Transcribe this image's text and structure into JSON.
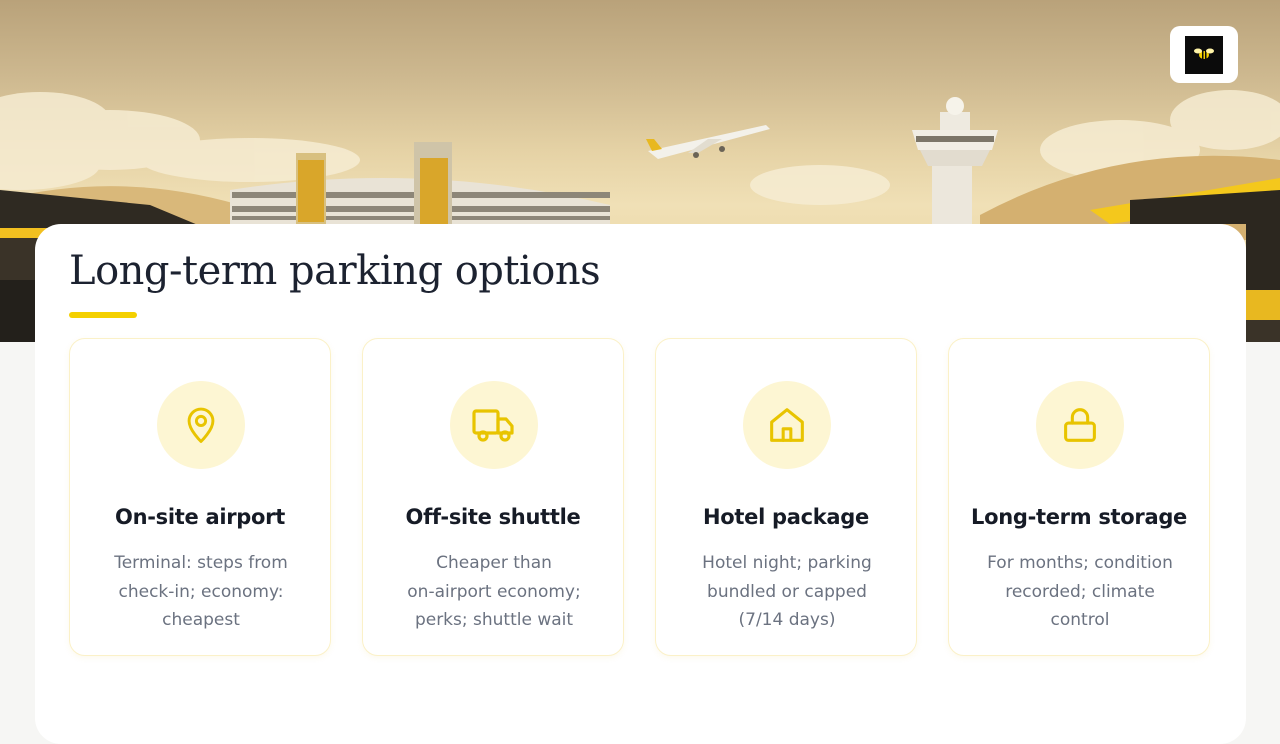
{
  "title": "Long-term parking options",
  "colors": {
    "accent": "#f4d000",
    "icon_stroke": "#e8c400",
    "icon_bg": "#fdf6d3",
    "title_text": "#1c2230",
    "body_text": "#6b7280"
  },
  "logo": {
    "icon": "bee-logo-icon"
  },
  "cards": [
    {
      "icon": "map-pin-icon",
      "title": "On-site airport",
      "lines": [
        "Terminal: steps from",
        "check-in; economy:",
        "cheapest"
      ]
    },
    {
      "icon": "truck-icon",
      "title": "Off-site shuttle",
      "lines": [
        "Cheaper than",
        "on-airport economy;",
        "perks; shuttle wait"
      ]
    },
    {
      "icon": "house-icon",
      "title": "Hotel package",
      "lines": [
        "Hotel night; parking",
        "bundled or capped",
        "(7/14 days)"
      ]
    },
    {
      "icon": "lock-icon",
      "title": "Long-term storage",
      "lines": [
        "For months; condition",
        "recorded; climate",
        "control"
      ]
    }
  ]
}
